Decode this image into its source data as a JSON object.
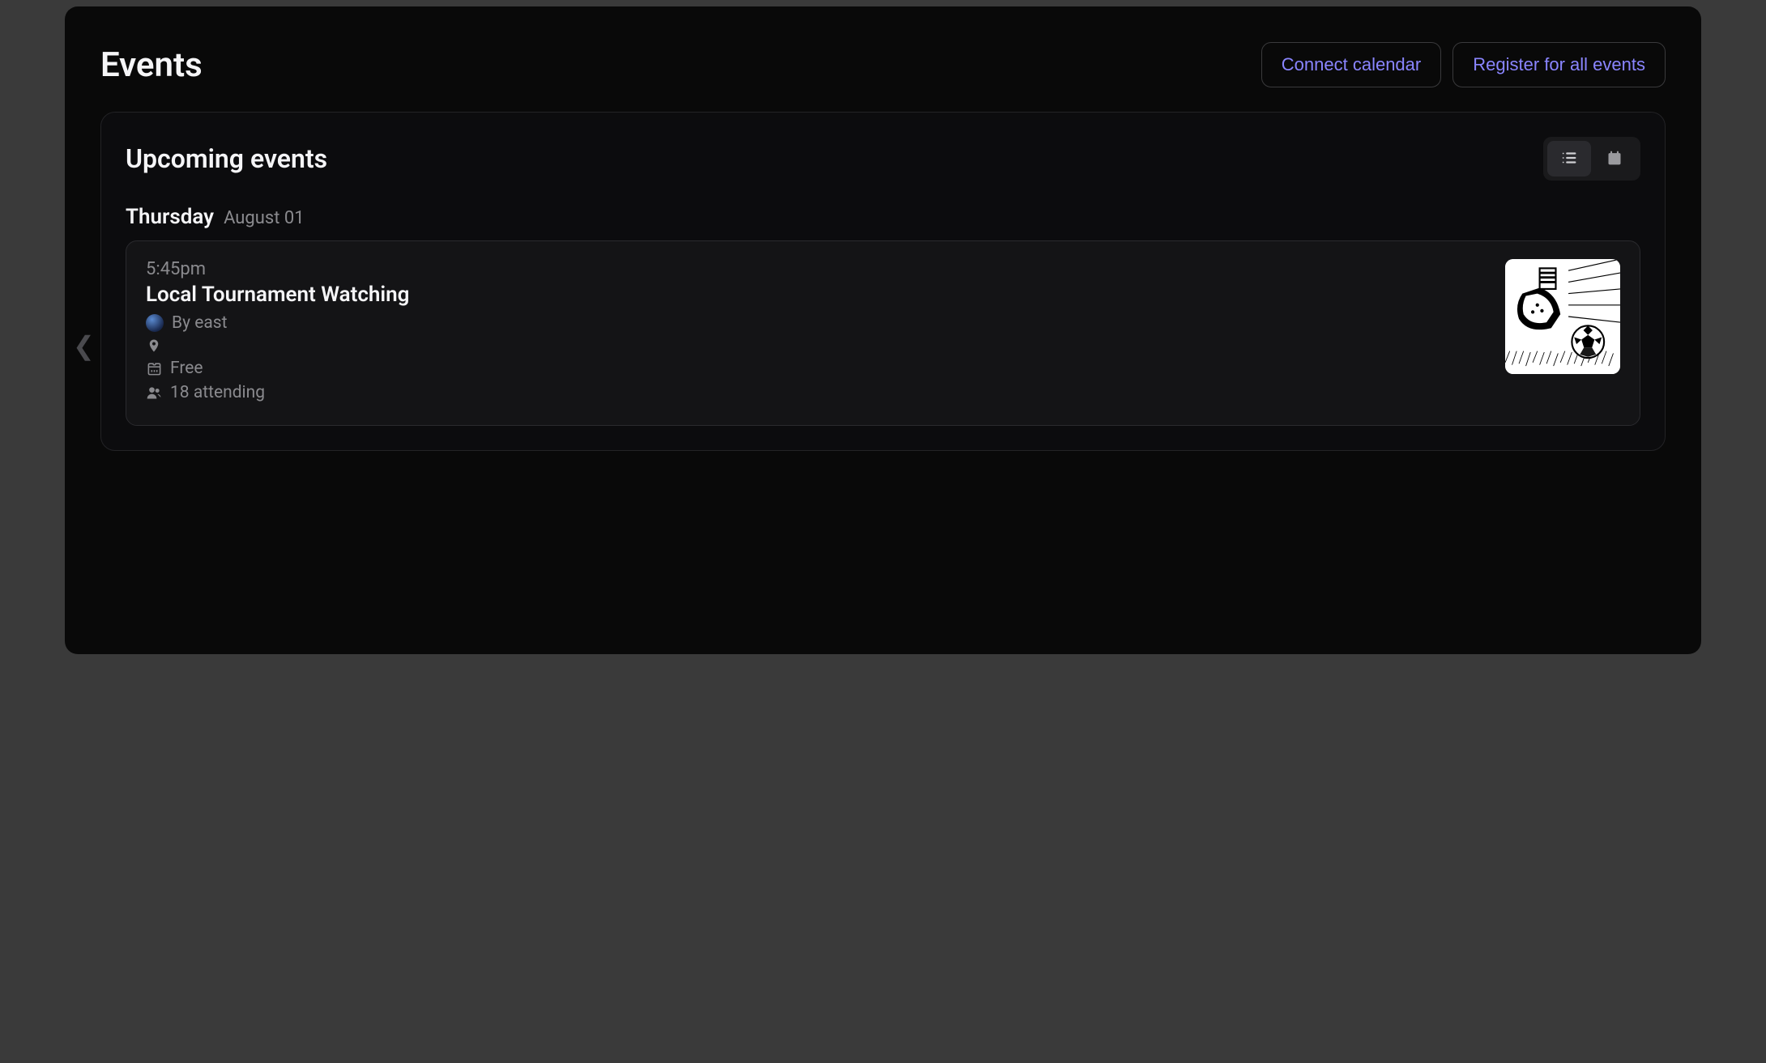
{
  "header": {
    "title": "Events",
    "connect_calendar_label": "Connect calendar",
    "register_all_label": "Register for all events"
  },
  "panel": {
    "title": "Upcoming events",
    "view": "list"
  },
  "days": [
    {
      "weekday": "Thursday",
      "date": "August 01",
      "events": [
        {
          "time": "5:45pm",
          "title": "Local Tournament Watching",
          "host": "By east",
          "location": "",
          "price": "Free",
          "attending": "18 attending"
        }
      ]
    }
  ]
}
